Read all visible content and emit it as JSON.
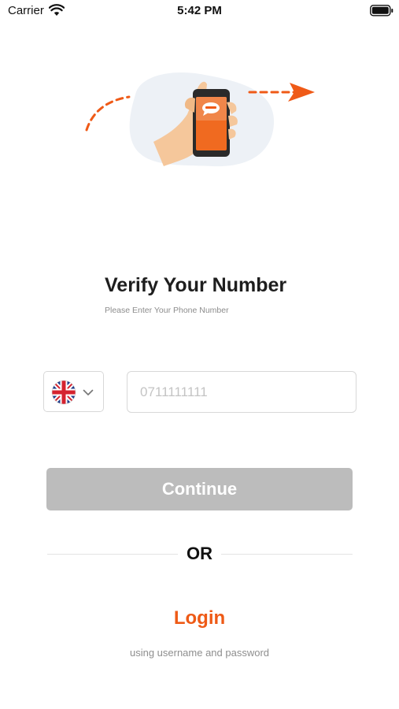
{
  "status_bar": {
    "carrier": "Carrier",
    "time": "5:42 PM"
  },
  "illustration": {
    "icon": "hand-holding-phone-illustration",
    "accent_color": "#ef5a17"
  },
  "heading": {
    "title": "Verify Your Number",
    "subtitle": "Please Enter Your Phone Number"
  },
  "phone_form": {
    "country_flag_icon": "uk-flag-icon",
    "phone_value": "",
    "phone_placeholder": "0711111111"
  },
  "continue_button": {
    "label": "Continue",
    "color": "#bcbcbc"
  },
  "divider": {
    "label": "OR"
  },
  "login": {
    "label": "Login",
    "hint": "using username and password",
    "color": "#ee5a16"
  }
}
